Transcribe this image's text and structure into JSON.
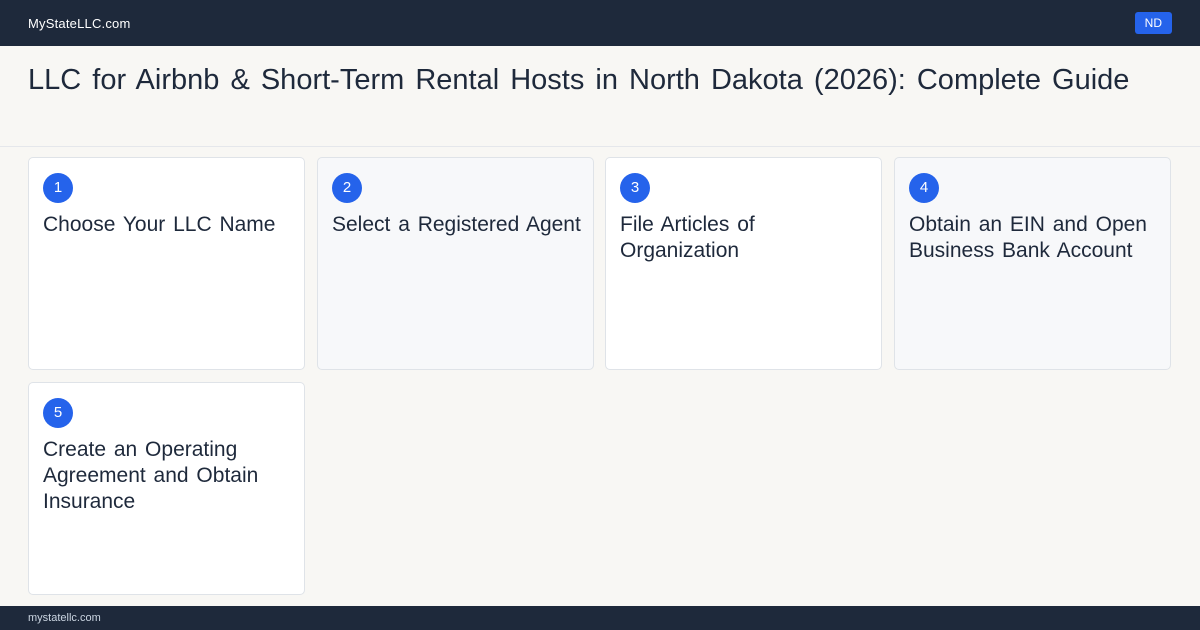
{
  "header": {
    "site_name": "MyStateLLC.com",
    "state_badge": "ND"
  },
  "page": {
    "title": "LLC for Airbnb & Short-Term Rental Hosts in North Dakota (2026): Complete Guide"
  },
  "steps": [
    {
      "number": "1",
      "title": "Choose Your LLC Name"
    },
    {
      "number": "2",
      "title": "Select a Registered Agent"
    },
    {
      "number": "3",
      "title": "File Articles of Organization"
    },
    {
      "number": "4",
      "title": "Obtain an EIN and Open Business Bank Account"
    },
    {
      "number": "5",
      "title": "Create an Operating Agreement and Obtain Insurance"
    }
  ],
  "footer": {
    "text": "mystatellc.com"
  },
  "colors": {
    "nav_background": "#1e293b",
    "accent": "#2563eb",
    "page_background": "#f8f7f4"
  }
}
